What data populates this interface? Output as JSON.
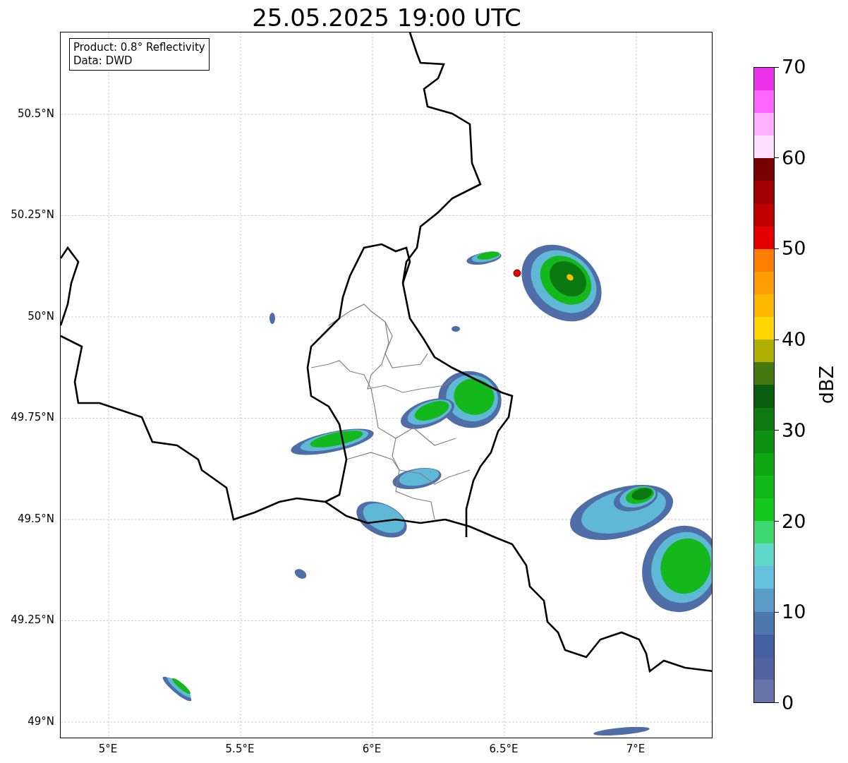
{
  "title": "25.05.2025 19:00 UTC",
  "info_box": [
    "Product: 0.8° Reflectivity",
    "Data: DWD"
  ],
  "map": {
    "lat_labels": [
      "50.5°N",
      "50.25°N",
      "50°N",
      "49.75°N",
      "49.5°N",
      "49.25°N",
      "49°N"
    ],
    "lon_labels": [
      "5°E",
      "5.5°E",
      "6°E",
      "6.5°E",
      "7°E"
    ]
  },
  "colorbar": {
    "label": "dBZ",
    "ticks": [
      "70",
      "60",
      "50",
      "40",
      "30",
      "20",
      "10",
      "0"
    ],
    "segments": [
      {
        "color": "#6674a8"
      },
      {
        "color": "#5264a0"
      },
      {
        "color": "#4460a4"
      },
      {
        "color": "#4c7ab0"
      },
      {
        "color": "#5a9cc8"
      },
      {
        "color": "#64c0dc"
      },
      {
        "color": "#5ed8c8"
      },
      {
        "color": "#3ed870"
      },
      {
        "color": "#12c81a"
      },
      {
        "color": "#10b818"
      },
      {
        "color": "#0ea814"
      },
      {
        "color": "#0c9010"
      },
      {
        "color": "#0c7a10"
      },
      {
        "color": "#085e0c"
      },
      {
        "color": "#467810"
      },
      {
        "color": "#b0b000"
      },
      {
        "color": "#ffd600"
      },
      {
        "color": "#ffb800"
      },
      {
        "color": "#ff9c00"
      },
      {
        "color": "#ff7e00"
      },
      {
        "color": "#e40000"
      },
      {
        "color": "#c00000"
      },
      {
        "color": "#a00000"
      },
      {
        "color": "#780000"
      },
      {
        "color": "#ffe0ff"
      },
      {
        "color": "#ffb0ff"
      },
      {
        "color": "#ff66ff"
      },
      {
        "color": "#ec32ec"
      }
    ]
  }
}
